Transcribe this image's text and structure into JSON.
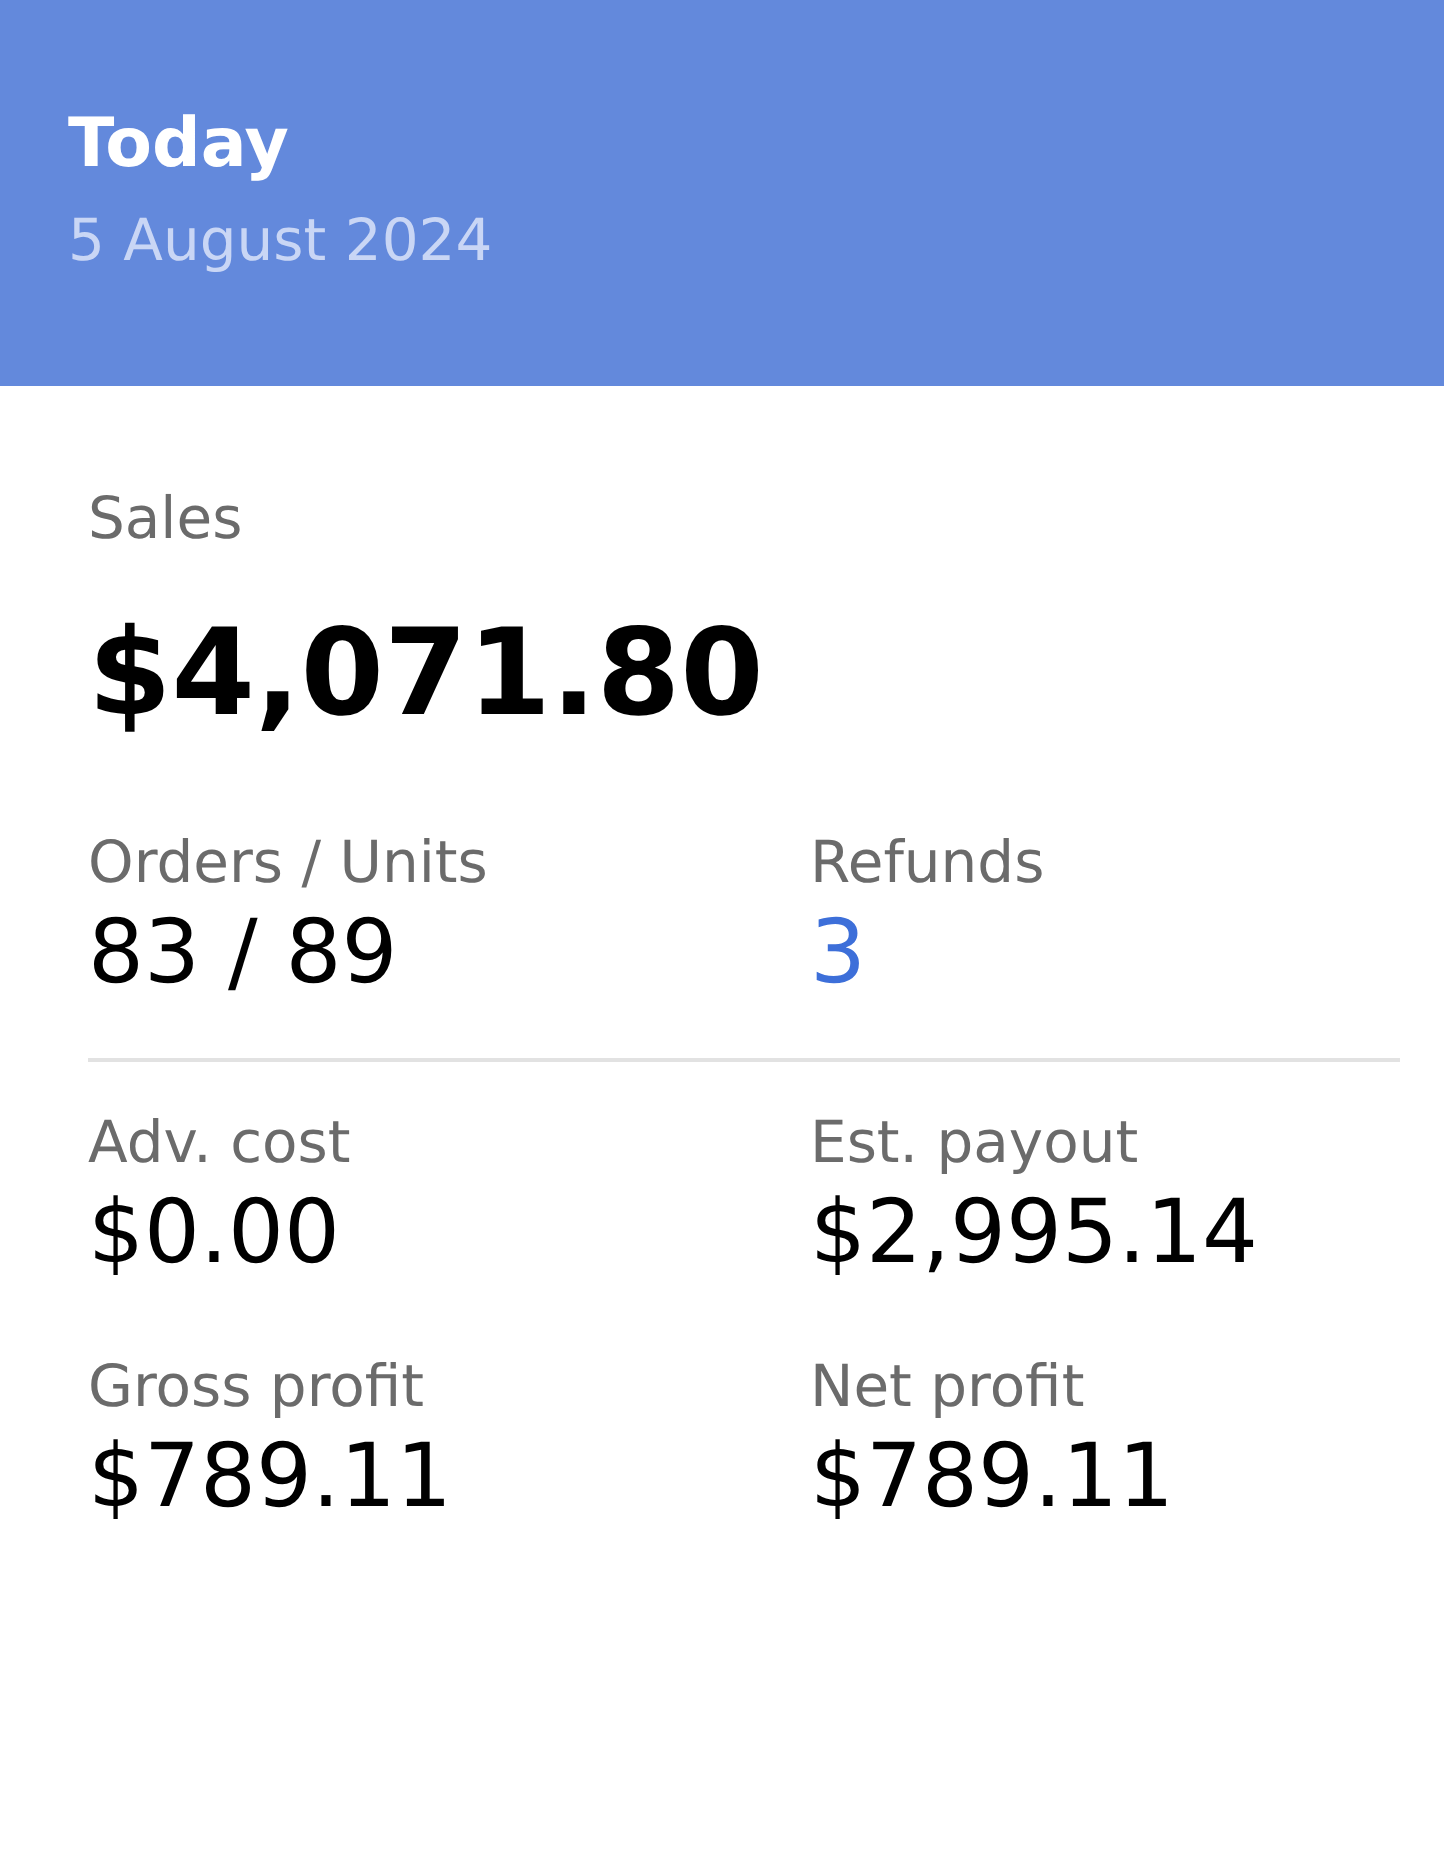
{
  "header": {
    "title": "Today",
    "date": "5 August 2024"
  },
  "sales": {
    "label": "Sales",
    "value": "$4,071.80"
  },
  "stat_groups": [
    {
      "stats": [
        {
          "label": "Orders / Units",
          "value": "83 / 89",
          "kind": "plain"
        },
        {
          "label": "Refunds",
          "value": "3",
          "kind": "link"
        }
      ]
    },
    {
      "stats": [
        {
          "label": "Adv. cost",
          "value": "$0.00",
          "kind": "plain"
        },
        {
          "label": "Est. payout",
          "value": "$2,995.14",
          "kind": "plain"
        },
        {
          "label": "Gross profit",
          "value": "$789.11",
          "kind": "plain"
        },
        {
          "label": "Net profit",
          "value": "$789.11",
          "kind": "plain"
        }
      ]
    }
  ]
}
